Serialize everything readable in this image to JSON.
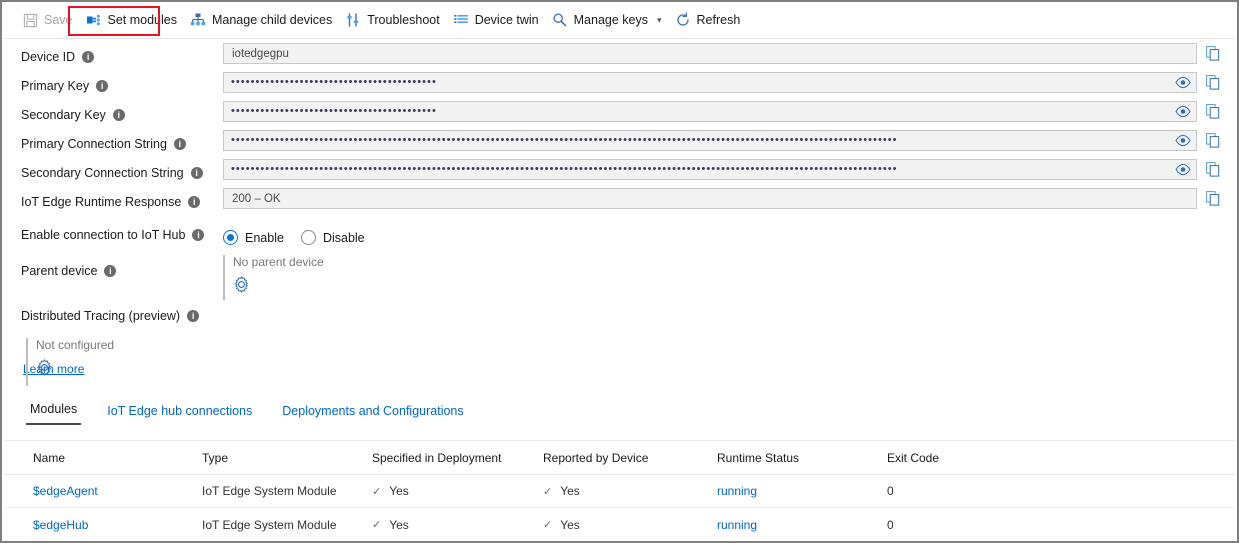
{
  "toolbar": {
    "items": [
      {
        "label": "Save",
        "icon": "save-icon",
        "disabled": true
      },
      {
        "label": "Set modules",
        "icon": "set-modules-icon",
        "disabled": false,
        "highlighted": true
      },
      {
        "label": "Manage child devices",
        "icon": "manage-child-devices-icon",
        "disabled": false
      },
      {
        "label": "Troubleshoot",
        "icon": "troubleshoot-icon",
        "disabled": false
      },
      {
        "label": "Device twin",
        "icon": "device-twin-icon",
        "disabled": false
      },
      {
        "label": "Manage keys",
        "icon": "manage-keys-icon",
        "disabled": false,
        "chevron": true
      },
      {
        "label": "Refresh",
        "icon": "refresh-icon",
        "disabled": false
      }
    ],
    "highlight_color": "#e81123"
  },
  "fields": {
    "device_id": {
      "label": "Device ID",
      "value": "iotedgegpu",
      "masked": false,
      "has_eye": false
    },
    "primary_key": {
      "label": "Primary Key",
      "value": "••••••••••••••••••••••••••••••••••••••••••",
      "masked": true,
      "has_eye": true
    },
    "secondary_key": {
      "label": "Secondary Key",
      "value": "••••••••••••••••••••••••••••••••••••••••••",
      "masked": true,
      "has_eye": true
    },
    "primary_connection_string": {
      "label": "Primary Connection String",
      "value": "••••••••••••••••••••••••••••••••••••••••••••••••••••••••••••••••••••••••••••••••••••••••••••••••••••••••••••••••••••••••••••••••••••••••",
      "masked": true,
      "has_eye": true
    },
    "secondary_connection_string": {
      "label": "Secondary Connection String",
      "value": "••••••••••••••••••••••••••••••••••••••••••••••••••••••••••••••••••••••••••••••••••••••••••••••••••••••••••••••••••••••••••••••••••••••••",
      "masked": true,
      "has_eye": true
    },
    "runtime_response": {
      "label": "IoT Edge Runtime Response",
      "value": "200 – OK",
      "masked": false,
      "has_eye": false
    }
  },
  "connection": {
    "label": "Enable connection to IoT Hub",
    "options": [
      {
        "label": "Enable",
        "selected": true
      },
      {
        "label": "Disable",
        "selected": false
      }
    ]
  },
  "parent_device": {
    "label": "Parent device",
    "status": "No parent device"
  },
  "distributed_tracing": {
    "label": "Distributed Tracing (preview)",
    "learn_more": "Learn more",
    "status": "Not configured"
  },
  "tabs": [
    {
      "label": "Modules",
      "active": true
    },
    {
      "label": "IoT Edge hub connections",
      "active": false
    },
    {
      "label": "Deployments and Configurations",
      "active": false
    }
  ],
  "table": {
    "columns": [
      "Name",
      "Type",
      "Specified in Deployment",
      "Reported by Device",
      "Runtime Status",
      "Exit Code"
    ],
    "rows": [
      {
        "name": "$edgeAgent",
        "type": "IoT Edge System Module",
        "specified_in_deployment": "Yes",
        "reported_by_device": "Yes",
        "runtime_status": "running",
        "exit_code": "0"
      },
      {
        "name": "$edgeHub",
        "type": "IoT Edge System Module",
        "specified_in_deployment": "Yes",
        "reported_by_device": "Yes",
        "runtime_status": "running",
        "exit_code": "0"
      }
    ],
    "check_glyph": "✓"
  },
  "colors": {
    "link": "#0066cc",
    "accent": "#0078d4",
    "field_bg": "#f2f2f2"
  }
}
